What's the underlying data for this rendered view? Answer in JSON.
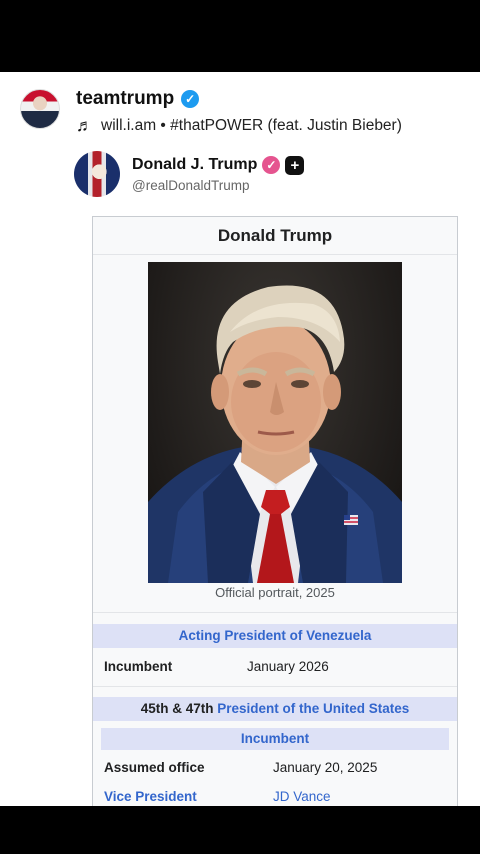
{
  "post": {
    "username": "teamtrump",
    "audio": "will.i.am • #thatPOWER (feat. Justin Bieber)"
  },
  "tweet": {
    "name": "Donald J. Trump",
    "handle": "@realDonaldTrump"
  },
  "infobox": {
    "title": "Donald Trump",
    "caption": "Official portrait, 2025",
    "section1": {
      "header": "Acting President of Venezuela",
      "label": "Incumbent",
      "value": "January 2026"
    },
    "section2": {
      "header_prefix": "45th & 47th",
      "header_link": "President of the United States",
      "subheader": "Incumbent",
      "rows": [
        {
          "label": "Assumed office",
          "value": "January 20, 2025"
        },
        {
          "label": "Vice President",
          "value": "JD Vance"
        }
      ]
    }
  },
  "colors": {
    "link": "#3366cc",
    "band": "#dde1f6",
    "verified": "#1d9bf0"
  },
  "icons": {
    "verified": "verified-check-icon",
    "music": "music-note-icon",
    "plus": "plus-badge-icon"
  }
}
